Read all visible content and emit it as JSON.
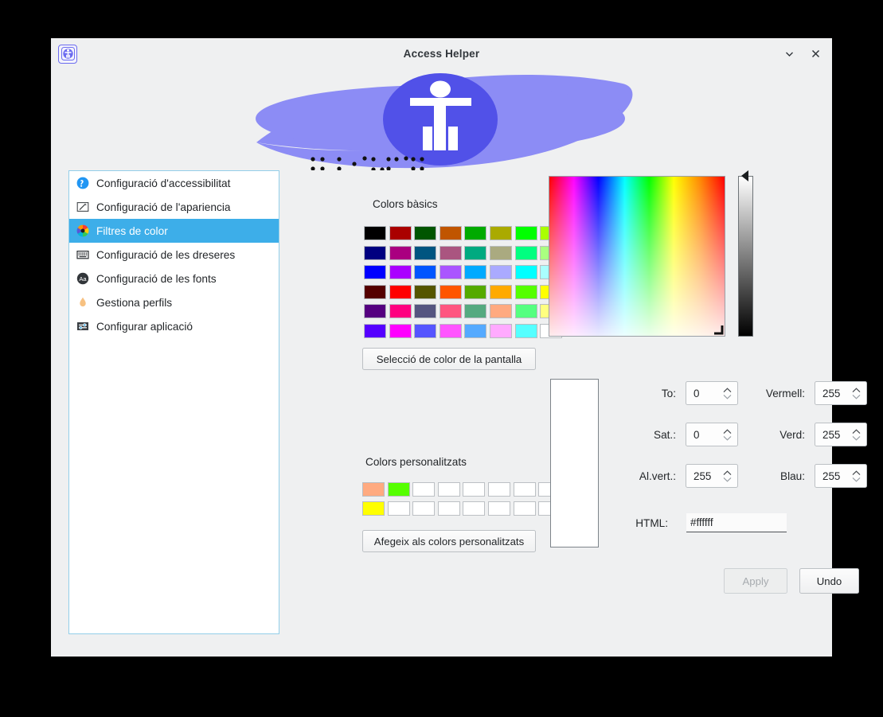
{
  "window": {
    "title": "Access Helper",
    "app_icon": "accessibility-icon",
    "minimize_icon": "chevron-down-icon",
    "close_icon": "close-icon"
  },
  "banner": {
    "figure_icon": "accessibility-person-icon",
    "lens_color": "#8c8cf5",
    "disc_color": "#5151e8",
    "braille_left": "braille-dots",
    "braille_right": "braille-dots"
  },
  "sidebar": {
    "items": [
      {
        "label": "Configuració d'accessibilitat",
        "icon": "accessibility-icon",
        "selected": false
      },
      {
        "label": "Configuració de l'apariencia",
        "icon": "pencil-icon",
        "selected": false
      },
      {
        "label": "Filtres de color",
        "icon": "color-wheel-icon",
        "selected": true
      },
      {
        "label": "Configuració de les dreseres",
        "icon": "keyboard-icon",
        "selected": false
      },
      {
        "label": "Configuració de les fonts",
        "icon": "font-icon",
        "selected": false
      },
      {
        "label": "Gestiona perfils",
        "icon": "flame-icon",
        "selected": false
      },
      {
        "label": "Configurar aplicació",
        "icon": "sliders-icon",
        "selected": false
      }
    ]
  },
  "color_dialog": {
    "basic_colors_label": "Colors bàsics",
    "basic_colors": [
      [
        "#000000",
        "#aa0000",
        "#005500",
        "#c05500",
        "#00aa00",
        "#aaaa00",
        "#00ff00",
        "#aaff00"
      ],
      [
        "#000080",
        "#aa0080",
        "#005580",
        "#aa5580",
        "#00aa80",
        "#aaaa80",
        "#00ff80",
        "#aaff80"
      ],
      [
        "#0000ff",
        "#aa00ff",
        "#0055ff",
        "#aa55ff",
        "#00aaff",
        "#aaaaff",
        "#00ffff",
        "#aaffff"
      ],
      [
        "#550000",
        "#ff0000",
        "#555500",
        "#ff5500",
        "#55aa00",
        "#ffaa00",
        "#55ff00",
        "#ffff00"
      ],
      [
        "#550080",
        "#ff0080",
        "#555580",
        "#ff5580",
        "#55aa80",
        "#ffaa80",
        "#55ff80",
        "#ffff80"
      ],
      [
        "#5500ff",
        "#ff00ff",
        "#5555ff",
        "#ff55ff",
        "#55aaff",
        "#ffaaff",
        "#55ffff",
        "#ffffff"
      ]
    ],
    "screen_picker_label": "Selecció de color de la pantalla",
    "custom_colors_label": "Colors personalitzats",
    "custom_colors": [
      [
        "#ffaa80",
        "#55ff00",
        null,
        null,
        null,
        null,
        null,
        null
      ],
      [
        "#ffff00",
        null,
        null,
        null,
        null,
        null,
        null,
        null
      ]
    ],
    "add_custom_label": "Afegeix als colors personalitzats",
    "preview_color": "#ffffff",
    "fields": {
      "hue_label": "To:",
      "hue_value": "0",
      "sat_label": "Sat.:",
      "sat_value": "0",
      "val_label": "Al.vert.:",
      "val_value": "255",
      "red_label": "Vermell:",
      "red_value": "255",
      "green_label": "Verd:",
      "green_value": "255",
      "blue_label": "Blau:",
      "blue_value": "255",
      "html_label": "HTML:",
      "html_value": "#ffffff"
    },
    "apply_label": "Apply",
    "apply_disabled": true,
    "undo_label": "Undo"
  }
}
